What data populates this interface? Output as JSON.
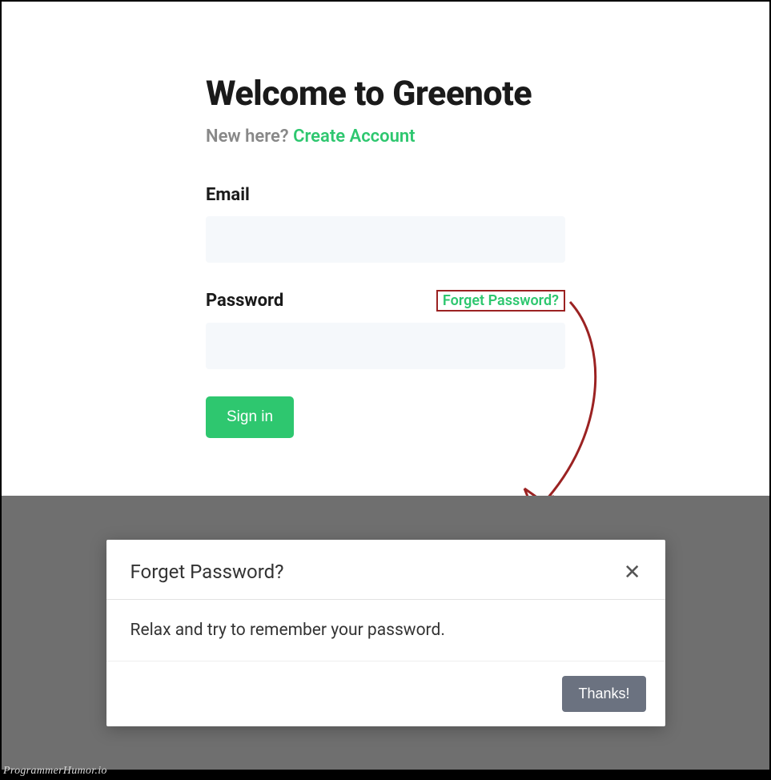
{
  "login": {
    "title": "Welcome to Greenote",
    "subtitle_text": "New here? ",
    "subtitle_link": "Create Account",
    "email_label": "Email",
    "email_value": "",
    "password_label": "Password",
    "password_value": "",
    "forgot_link": "Forget Password?",
    "signin_label": "Sign in"
  },
  "modal": {
    "title": "Forget Password?",
    "body": "Relax and try to remember your password.",
    "close_glyph": "✕",
    "thanks_label": "Thanks!"
  },
  "watermark": "ProgrammerHumor.io",
  "colors": {
    "accent": "#2ec76f",
    "modal_backdrop": "#6f6f6f",
    "highlight_border": "#9b2222"
  }
}
